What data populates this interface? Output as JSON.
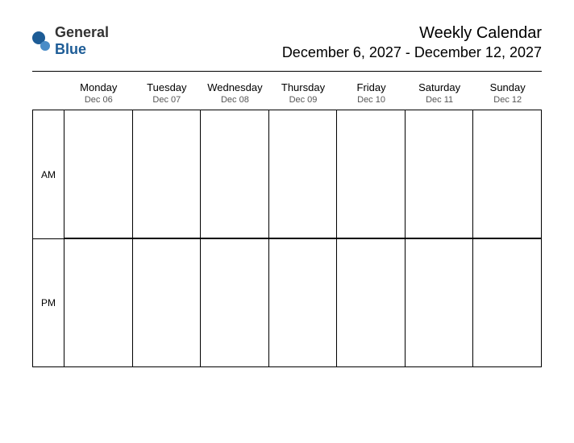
{
  "logo": {
    "general": "General",
    "blue": "Blue"
  },
  "title": "Weekly Calendar",
  "subtitle": "December 6, 2027 - December 12, 2027",
  "days": [
    {
      "name": "Monday",
      "date": "Dec 06"
    },
    {
      "name": "Tuesday",
      "date": "Dec 07"
    },
    {
      "name": "Wednesday",
      "date": "Dec 08"
    },
    {
      "name": "Thursday",
      "date": "Dec 09"
    },
    {
      "name": "Friday",
      "date": "Dec 10"
    },
    {
      "name": "Saturday",
      "date": "Dec 11"
    },
    {
      "name": "Sunday",
      "date": "Dec 12"
    }
  ],
  "periods": {
    "am": "AM",
    "pm": "PM"
  }
}
